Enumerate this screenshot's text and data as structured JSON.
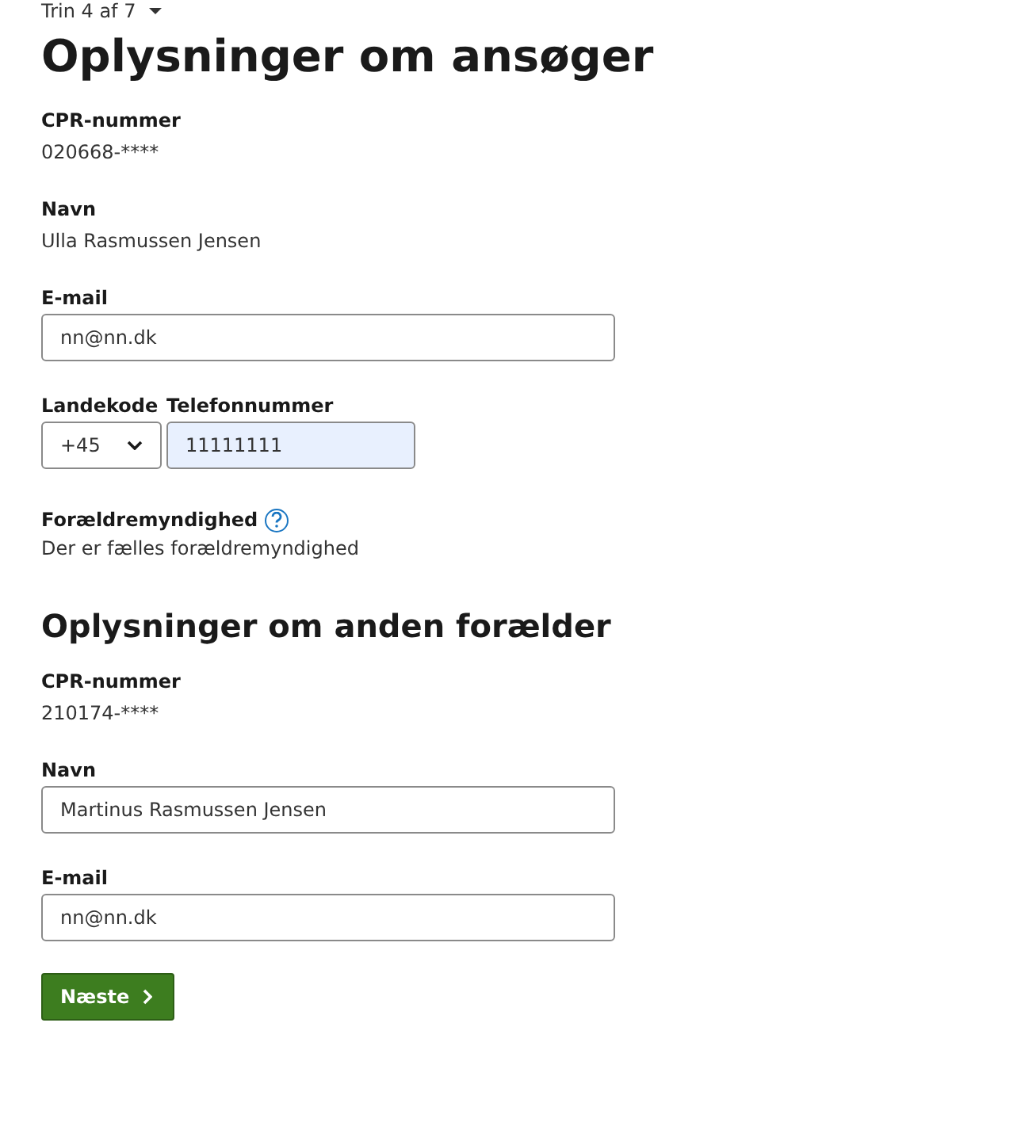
{
  "step": {
    "label": "Trin 4 af 7"
  },
  "sections": [
    {
      "heading": "Oplysninger om ansøger",
      "kind": "main",
      "fields": [
        {
          "kind": "static",
          "label": "CPR-nummer",
          "value": "020668-****"
        },
        {
          "kind": "static",
          "label": "Navn",
          "value": "Ulla Rasmussen Jensen"
        },
        {
          "kind": "input",
          "label": "E-mail",
          "value": "nn@nn.dk"
        },
        {
          "kind": "phone",
          "country_label": "Landekode",
          "country_value": "+45",
          "phone_label": "Telefonnummer",
          "phone_value": "11111111",
          "autofilled": true
        },
        {
          "kind": "help",
          "label": "Forældremyndighed",
          "value": "Der er fælles forældremyndighed"
        }
      ]
    },
    {
      "heading": "Oplysninger om anden forælder",
      "kind": "sub",
      "fields": [
        {
          "kind": "static",
          "label": "CPR-nummer",
          "value": "210174-****"
        },
        {
          "kind": "input",
          "label": "Navn",
          "value": "Martinus Rasmussen Jensen"
        },
        {
          "kind": "input",
          "label": "E-mail",
          "value": "nn@nn.dk"
        }
      ]
    }
  ],
  "button": {
    "label": "Næste"
  }
}
